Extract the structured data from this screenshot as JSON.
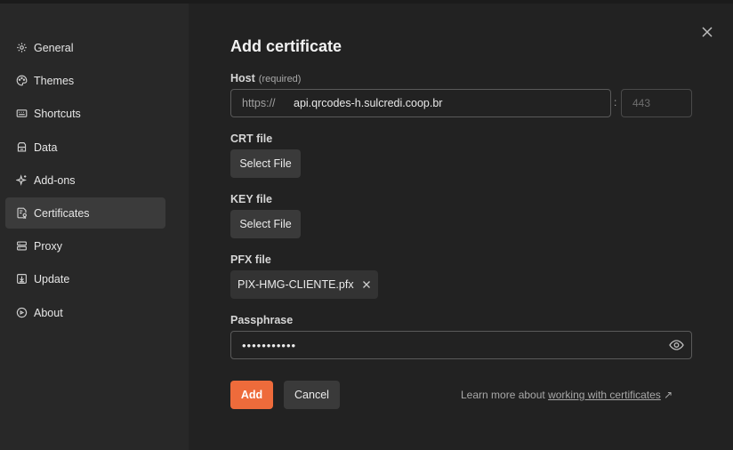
{
  "sidebar": {
    "items": [
      {
        "label": "General",
        "icon": "gear-icon"
      },
      {
        "label": "Themes",
        "icon": "palette-icon"
      },
      {
        "label": "Shortcuts",
        "icon": "keyboard-icon"
      },
      {
        "label": "Data",
        "icon": "database-icon"
      },
      {
        "label": "Add-ons",
        "icon": "sparkle-icon"
      },
      {
        "label": "Certificates",
        "icon": "certificate-icon",
        "active": true
      },
      {
        "label": "Proxy",
        "icon": "server-icon"
      },
      {
        "label": "Update",
        "icon": "download-icon"
      },
      {
        "label": "About",
        "icon": "info-icon"
      }
    ]
  },
  "dialog": {
    "title": "Add certificate",
    "host": {
      "label": "Host",
      "hint": "(required)",
      "prefix": "https://",
      "value": "api.qrcodes-h.sulcredi.coop.br",
      "separator": ":",
      "port_placeholder": "443"
    },
    "crt": {
      "label": "CRT file",
      "button": "Select File"
    },
    "key": {
      "label": "KEY file",
      "button": "Select File"
    },
    "pfx": {
      "label": "PFX file",
      "file_name": "PIX-HMG-CLIENTE.pfx"
    },
    "passphrase": {
      "label": "Passphrase",
      "value": "•••••••••••"
    },
    "actions": {
      "add": "Add",
      "cancel": "Cancel"
    },
    "learn_more": {
      "prefix": "Learn more about",
      "link": "working with certificates",
      "arrow": "↗"
    }
  },
  "colors": {
    "accent": "#ee6b3b",
    "background": "#222222",
    "sidebar": "#282828",
    "active_item": "#3b3b3b"
  }
}
